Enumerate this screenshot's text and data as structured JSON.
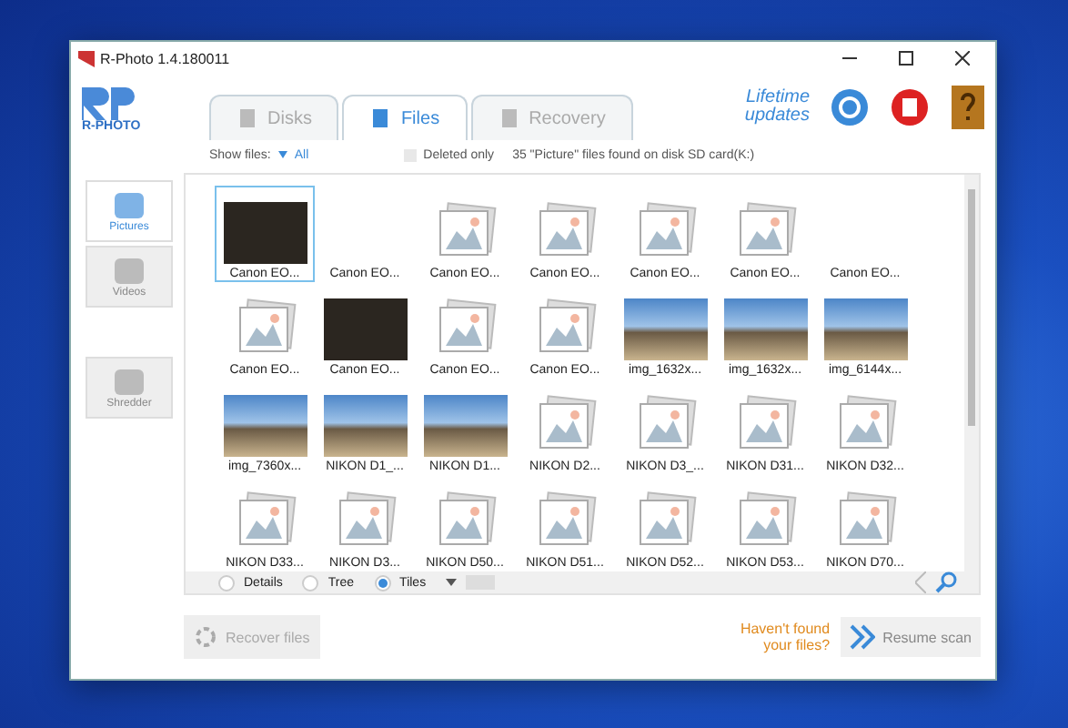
{
  "window": {
    "title": "R-Photo 1.4.180011"
  },
  "logo": {
    "text": "R-PHOTO"
  },
  "tabs": [
    {
      "label": "Disks",
      "selected": false
    },
    {
      "label": "Files",
      "selected": true
    },
    {
      "label": "Recovery",
      "selected": false
    }
  ],
  "header": {
    "lifetime": "Lifetime updates"
  },
  "filter": {
    "show_label": "Show files:",
    "show_value": "All",
    "deleted_only": {
      "label": "Deleted only",
      "checked": false
    },
    "status": "35 \"Picture\" files found on disk SD card(K:)"
  },
  "sidebar": {
    "items": [
      {
        "label": "Pictures",
        "selected": true
      },
      {
        "label": "Videos",
        "selected": false
      },
      {
        "label": "Shredder",
        "selected": false
      }
    ]
  },
  "tiles": [
    {
      "name": "Canon EO...",
      "kind": "dark",
      "selected": true
    },
    {
      "name": "Canon EO...",
      "kind": "blank",
      "selected": false
    },
    {
      "name": "Canon EO...",
      "kind": "placeholder",
      "selected": false
    },
    {
      "name": "Canon EO...",
      "kind": "placeholder",
      "selected": false
    },
    {
      "name": "Canon EO...",
      "kind": "placeholder",
      "selected": false
    },
    {
      "name": "Canon EO...",
      "kind": "placeholder",
      "selected": false
    },
    {
      "name": "Canon EO...",
      "kind": "blank",
      "selected": false
    },
    {
      "name": "Canon EO...",
      "kind": "placeholder",
      "selected": false
    },
    {
      "name": "Canon EO...",
      "kind": "dark",
      "selected": false
    },
    {
      "name": "Canon EO...",
      "kind": "placeholder",
      "selected": false
    },
    {
      "name": "Canon EO...",
      "kind": "placeholder",
      "selected": false
    },
    {
      "name": "img_1632x...",
      "kind": "photo",
      "selected": false
    },
    {
      "name": "img_1632x...",
      "kind": "photo",
      "selected": false
    },
    {
      "name": "img_6144x...",
      "kind": "photo",
      "selected": false
    },
    {
      "name": "img_7360x...",
      "kind": "photo",
      "selected": false
    },
    {
      "name": "NIKON D1_...",
      "kind": "photo",
      "selected": false
    },
    {
      "name": "NIKON D1...",
      "kind": "photo",
      "selected": false
    },
    {
      "name": "NIKON D2...",
      "kind": "placeholder",
      "selected": false
    },
    {
      "name": "NIKON D3_...",
      "kind": "placeholder",
      "selected": false
    },
    {
      "name": "NIKON D31...",
      "kind": "placeholder",
      "selected": false
    },
    {
      "name": "NIKON D32...",
      "kind": "placeholder",
      "selected": false
    },
    {
      "name": "NIKON D33...",
      "kind": "placeholder",
      "selected": false
    },
    {
      "name": "NIKON D3...",
      "kind": "placeholder",
      "selected": false
    },
    {
      "name": "NIKON D50...",
      "kind": "placeholder",
      "selected": false
    },
    {
      "name": "NIKON D51...",
      "kind": "placeholder",
      "selected": false
    },
    {
      "name": "NIKON D52...",
      "kind": "placeholder",
      "selected": false
    },
    {
      "name": "NIKON D53...",
      "kind": "placeholder",
      "selected": false
    },
    {
      "name": "NIKON D70...",
      "kind": "placeholder",
      "selected": false
    }
  ],
  "view_modes": [
    {
      "label": "Details",
      "selected": false
    },
    {
      "label": "Tree",
      "selected": false
    },
    {
      "label": "Tiles",
      "selected": true
    }
  ],
  "footer": {
    "recover": {
      "label": "Recover files",
      "disabled": true
    },
    "hint": "Haven't found your files?",
    "resume": "Resume scan"
  }
}
